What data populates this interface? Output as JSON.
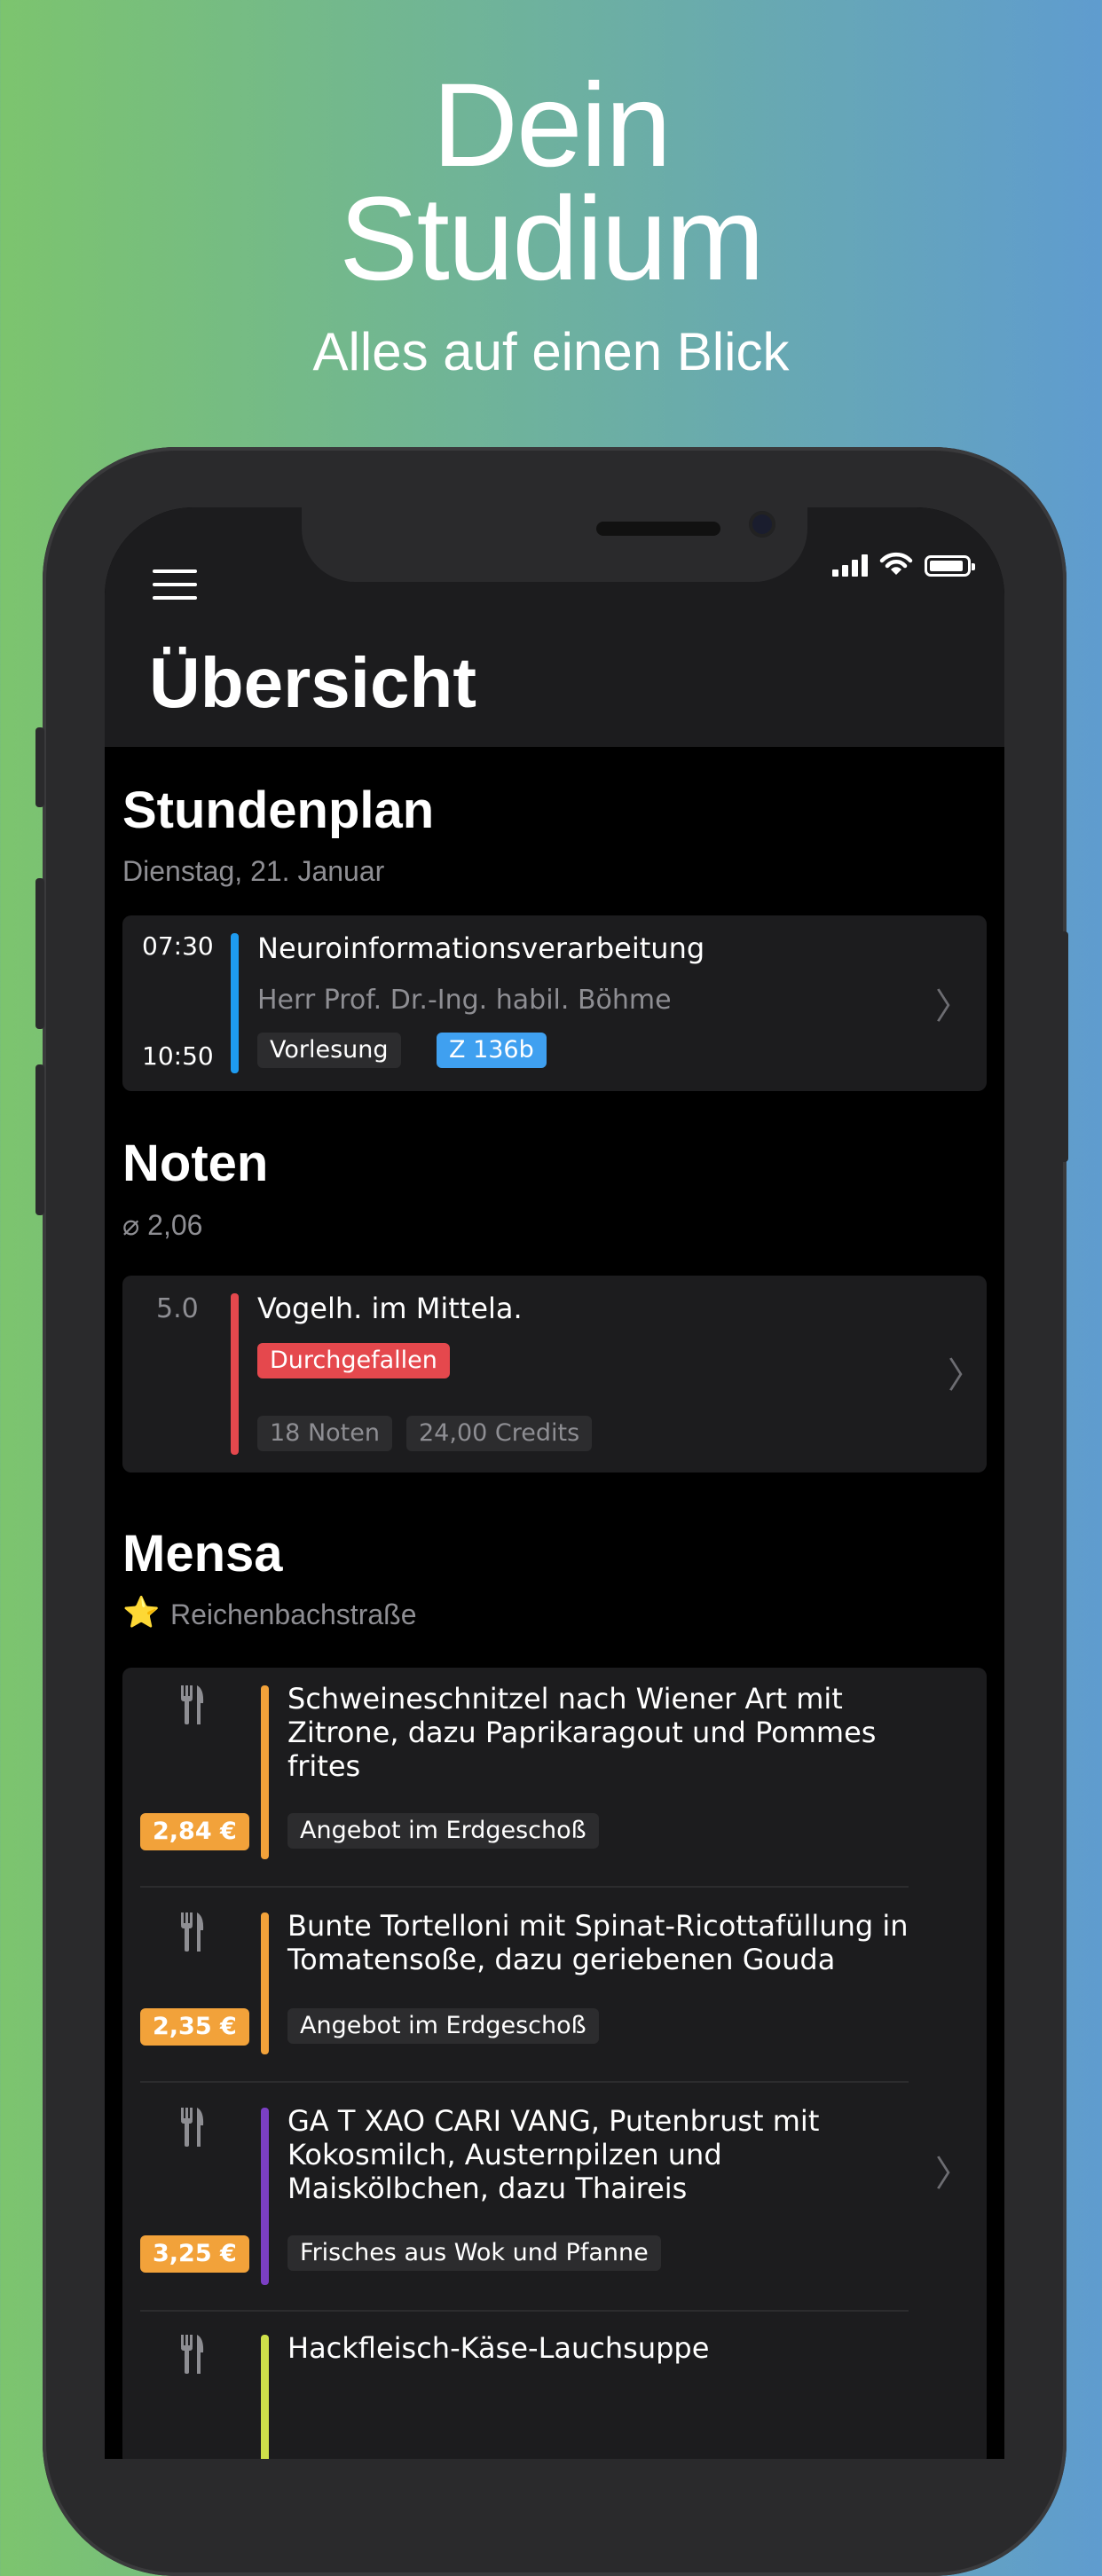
{
  "hero": {
    "title_line1": "Dein",
    "title_line2": "Studium",
    "subtitle": "Alles auf einen Blick"
  },
  "header": {
    "title": "Übersicht",
    "menu_icon": "hamburger-menu-icon"
  },
  "status_bar": {
    "icons": [
      "signal-icon",
      "wifi-icon",
      "battery-icon"
    ]
  },
  "stundenplan": {
    "title": "Stundenplan",
    "date": "Dienstag, 21. Januar",
    "entry": {
      "start": "07:30",
      "end": "10:50",
      "title": "Neuroinformationsverarbeitung",
      "lecturer": "Herr Prof. Dr.-Ing. habil. Böhme",
      "type_tag": "Vorlesung",
      "room_tag": "Z 136b",
      "accent": "#1e9bf0",
      "room_color": "#3fa0f0"
    }
  },
  "noten": {
    "title": "Noten",
    "average": "⌀ 2,06",
    "entry": {
      "grade": "5.0",
      "title": "Vogelh. im Mittela.",
      "status_tag": "Durchgefallen",
      "count_tag": "18 Noten",
      "credits_tag": "24,00 Credits",
      "accent": "#e5484d"
    }
  },
  "mensa": {
    "title": "Mensa",
    "location": "Reichenbachstraße",
    "meals": [
      {
        "line1": "Schweineschnitzel nach Wiener Art mit",
        "line2": "Zitrone, dazu Paprikaragout und Pommes",
        "line3": "frites",
        "price": "2,84 €",
        "tag": "Angebot im Erdgeschoß",
        "accent": "#f2a23a"
      },
      {
        "line1": "Bunte Tortelloni mit Spinat-Ricottafüllung in",
        "line2": "Tomatensoße, dazu geriebenen Gouda",
        "price": "2,35 €",
        "tag": "Angebot im Erdgeschoß",
        "accent": "#f2a23a"
      },
      {
        "line1": "GA T XAO CARI VANG, Putenbrust mit",
        "line2": "Kokosmilch, Austernpilzen und",
        "line3": "Maiskölbchen, dazu Thaireis",
        "price": "3,25 €",
        "tag": "Frisches aus Wok und Pfanne",
        "accent": "#7b3fc4"
      },
      {
        "line1": "Hackfleisch-Käse-Lauchsuppe",
        "accent": "#cfe04a"
      }
    ]
  },
  "chevron": "〉"
}
